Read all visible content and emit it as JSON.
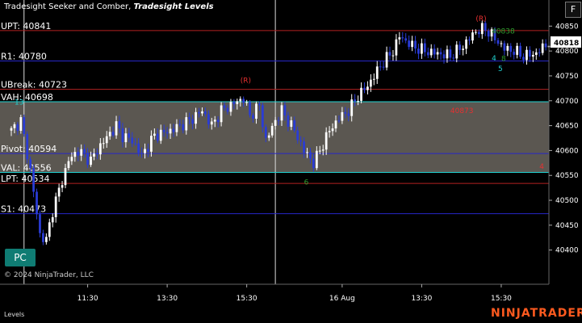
{
  "header": {
    "indicator": "Tradesight Seeker and Comber,",
    "study": "Tradesight Levels"
  },
  "buttons": {
    "f_label": "F",
    "pc_label": "PC"
  },
  "footer": {
    "copyright": "© 2024 NinjaTrader, LLC",
    "panel_label": "Levels",
    "brand": "NINJATRADER"
  },
  "colors": {
    "background": "#000000",
    "value_area": "#6b665f",
    "resistance": "#b22222",
    "support": "#2727c8",
    "value_line": "#22d3d3",
    "up_bar": "#ffffff",
    "down_bar": "#2a3cd6",
    "seek_count": "#2e9d2e",
    "comb_count": "#22d3d3",
    "brand": "#ff5a1f"
  },
  "chart_data": {
    "type": "candlestick",
    "ylim": [
      40380,
      40870
    ],
    "y_ticks": [
      40400,
      40450,
      40500,
      40550,
      40600,
      40650,
      40700,
      40750,
      40800,
      40850
    ],
    "x_ticks": [
      {
        "label": "11:30",
        "bar": 24
      },
      {
        "label": "13:30",
        "bar": 49
      },
      {
        "label": "15:30",
        "bar": 74
      },
      {
        "label": "16 Aug",
        "bar": 104
      },
      {
        "label": "13:30",
        "bar": 129
      },
      {
        "label": "15:30",
        "bar": 154
      }
    ],
    "bar_count": 170,
    "last_price": 40818,
    "value_area": {
      "low": 40556,
      "high": 40698
    },
    "levels": [
      {
        "label": "UPT: 40841",
        "value": 40841,
        "color": "#b22222"
      },
      {
        "label": "R1: 40780",
        "value": 40780,
        "color": "#2727c8"
      },
      {
        "label": "UBreak: 40723",
        "value": 40723,
        "color": "#b22222"
      },
      {
        "label": "VAH: 40698",
        "value": 40698,
        "color": "#22d3d3"
      },
      {
        "label": "Pivot: 40594",
        "value": 40594,
        "color": "#2727c8"
      },
      {
        "label": "VAL: 40556",
        "value": 40556,
        "color": "#22d3d3"
      },
      {
        "label": "LPT: 40534",
        "value": 40534,
        "color": "#b22222"
      },
      {
        "label": "S1: 40473",
        "value": 40473,
        "color": "#2727c8"
      }
    ],
    "session_separators": [
      4,
      83
    ],
    "anchors": [
      [
        0,
        40640
      ],
      [
        3,
        40660
      ],
      [
        6,
        40560
      ],
      [
        9,
        40430
      ],
      [
        11,
        40420
      ],
      [
        13,
        40480
      ],
      [
        16,
        40540
      ],
      [
        18,
        40580
      ],
      [
        21,
        40600
      ],
      [
        25,
        40580
      ],
      [
        28,
        40610
      ],
      [
        33,
        40650
      ],
      [
        35,
        40630
      ],
      [
        38,
        40620
      ],
      [
        41,
        40590
      ],
      [
        45,
        40630
      ],
      [
        50,
        40640
      ],
      [
        56,
        40660
      ],
      [
        60,
        40680
      ],
      [
        63,
        40650
      ],
      [
        66,
        40680
      ],
      [
        70,
        40695
      ],
      [
        73,
        40705
      ],
      [
        75,
        40670
      ],
      [
        78,
        40690
      ],
      [
        80,
        40620
      ],
      [
        83,
        40660
      ],
      [
        85,
        40680
      ],
      [
        89,
        40640
      ],
      [
        92,
        40600
      ],
      [
        95,
        40575
      ],
      [
        97,
        40600
      ],
      [
        100,
        40640
      ],
      [
        103,
        40665
      ],
      [
        106,
        40680
      ],
      [
        109,
        40710
      ],
      [
        112,
        40730
      ],
      [
        114,
        40750
      ],
      [
        116,
        40770
      ],
      [
        120,
        40800
      ],
      [
        122,
        40830
      ],
      [
        126,
        40810
      ],
      [
        130,
        40800
      ],
      [
        134,
        40795
      ],
      [
        138,
        40790
      ],
      [
        142,
        40810
      ],
      [
        146,
        40840
      ],
      [
        149,
        40845
      ],
      [
        152,
        40825
      ],
      [
        155,
        40805
      ],
      [
        158,
        40800
      ],
      [
        161,
        40790
      ],
      [
        165,
        40795
      ],
      [
        169,
        40818
      ]
    ],
    "annotations": [
      {
        "text": "(R)",
        "bar": 72,
        "price": 40736,
        "color": "#e83030"
      },
      {
        "text": "(R)",
        "bar": 146,
        "price": 40860,
        "color": "#e83030"
      },
      {
        "text": "40873",
        "bar": 138,
        "price": 40675,
        "color": "#e83030"
      },
      {
        "text": "40838",
        "bar": 151,
        "price": 40835,
        "color": "#2e9d2e"
      },
      {
        "text": "6",
        "bar": 92,
        "price": 40532,
        "color": "#2e9d2e"
      },
      {
        "text": "13",
        "bar": 1,
        "price": 40692,
        "color": "#22d3d3"
      },
      {
        "text": "5",
        "bar": 153,
        "price": 40760,
        "color": "#22d3d3"
      },
      {
        "text": "4",
        "bar": 151,
        "price": 40781,
        "color": "#22d3d3"
      },
      {
        "text": "8",
        "bar": 154,
        "price": 40780,
        "color": "#2e9d2e"
      },
      {
        "text": "4",
        "bar": 166,
        "price": 40563,
        "color": "#e83030"
      }
    ]
  }
}
